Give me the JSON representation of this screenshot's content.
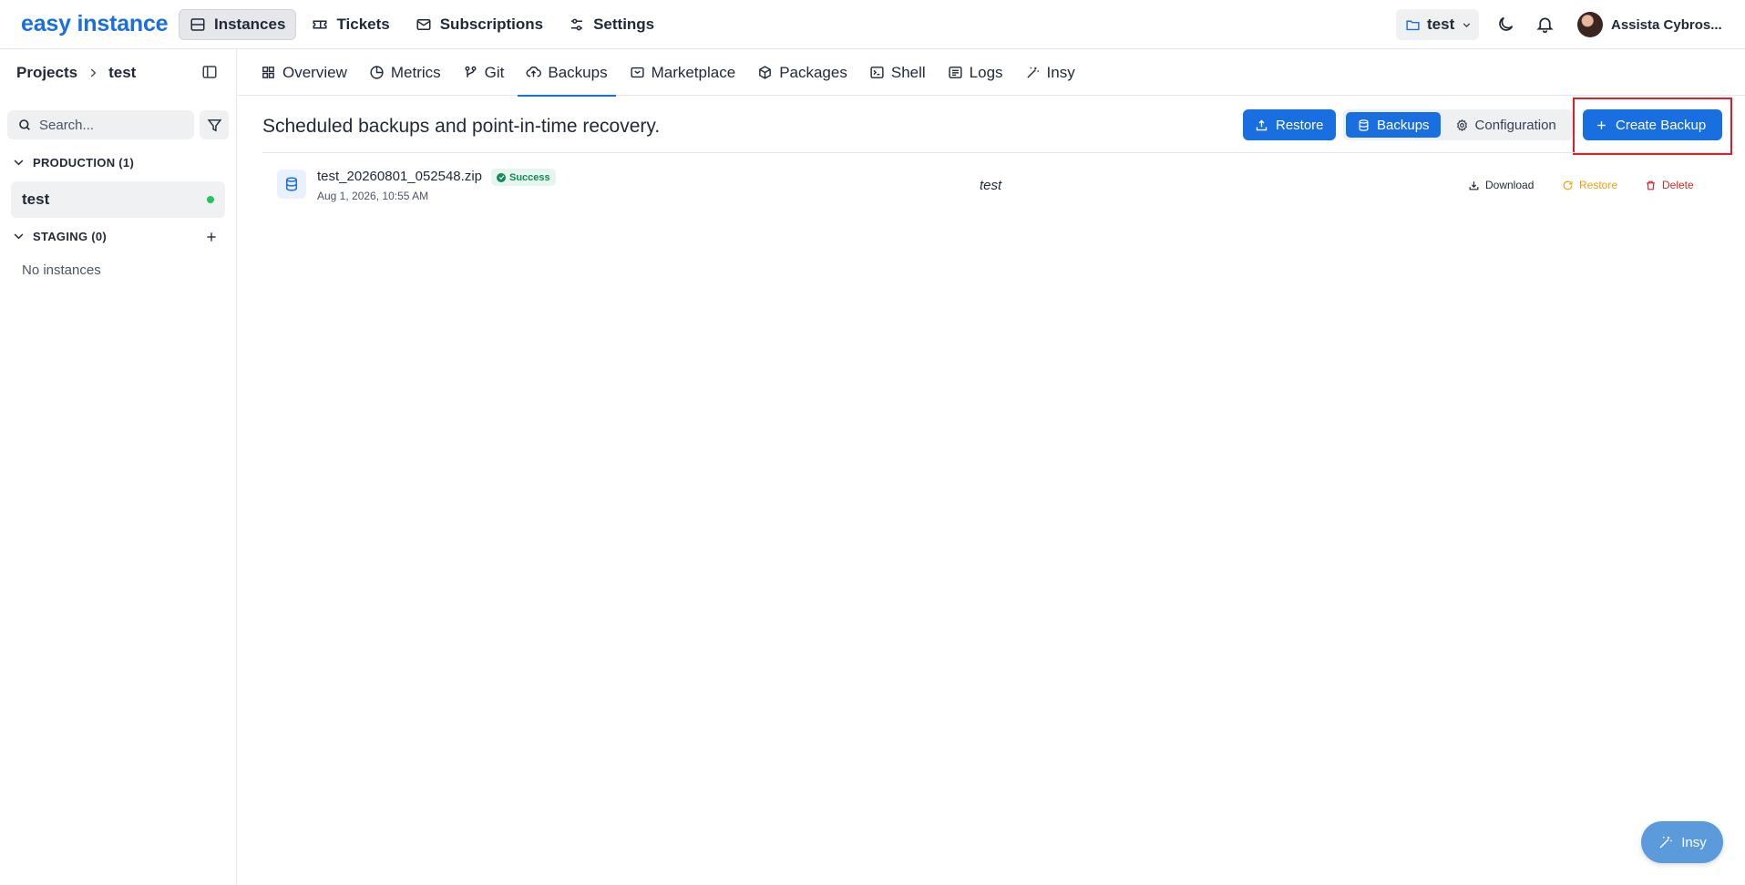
{
  "app": {
    "logo": "easy instance"
  },
  "topnav": {
    "items": [
      {
        "label": "Instances",
        "icon": "server-icon",
        "active": true
      },
      {
        "label": "Tickets",
        "icon": "ticket-icon"
      },
      {
        "label": "Subscriptions",
        "icon": "mail-icon"
      },
      {
        "label": "Settings",
        "icon": "sliders-icon"
      }
    ],
    "project": "test",
    "user": "Assista Cybros..."
  },
  "sidebar": {
    "breadcrumb_root": "Projects",
    "breadcrumb_current": "test",
    "search_placeholder": "Search...",
    "groups": {
      "production": {
        "label": "PRODUCTION (1)",
        "items": [
          {
            "label": "test",
            "status": "running"
          }
        ]
      },
      "staging": {
        "label": "STAGING (0)",
        "empty": "No instances"
      }
    }
  },
  "tabs": [
    {
      "label": "Overview",
      "icon": "grid-icon"
    },
    {
      "label": "Metrics",
      "icon": "pie-chart-icon"
    },
    {
      "label": "Git",
      "icon": "git-icon"
    },
    {
      "label": "Backups",
      "icon": "cloud-upload-icon",
      "active": true
    },
    {
      "label": "Marketplace",
      "icon": "store-icon"
    },
    {
      "label": "Packages",
      "icon": "package-icon"
    },
    {
      "label": "Shell",
      "icon": "terminal-icon"
    },
    {
      "label": "Logs",
      "icon": "list-icon"
    },
    {
      "label": "Insy",
      "icon": "magic-wand-icon"
    }
  ],
  "backups": {
    "subtitle": "Scheduled backups and point-in-time recovery.",
    "restore_label": "Restore",
    "view_backups": "Backups",
    "view_configuration": "Configuration",
    "create_label": "Create Backup",
    "rows": [
      {
        "file": "test_20260801_052548.zip",
        "status": "Success",
        "date": "Aug 1, 2026, 10:55 AM",
        "instance": "test",
        "download": "Download",
        "restore": "Restore",
        "delete": "Delete"
      }
    ]
  },
  "fab": {
    "label": "Insy"
  },
  "colors": {
    "accent": "#1a6fe0",
    "success": "#0f8a5a",
    "warning": "#f59e0b",
    "danger": "#dc2626",
    "highlight": "#e11d2a"
  }
}
